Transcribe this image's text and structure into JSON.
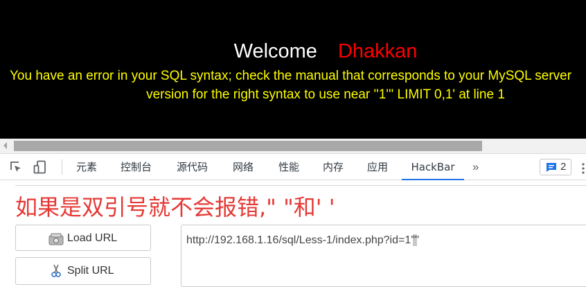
{
  "page": {
    "welcome_label": "Welcome",
    "welcome_name": "Dhakkan",
    "error_line1": "You have an error in your SQL syntax; check the manual that corresponds to your MySQL server",
    "error_line2": "version for the right syntax to use near ''1''' LIMIT 0,1' at line 1",
    "colors": {
      "background": "#000000",
      "welcome": "#ffffff",
      "name": "#ff0000",
      "error": "#ffff00"
    }
  },
  "devtools": {
    "tools": [
      "inspect-element-icon",
      "device-toolbar-icon"
    ],
    "tabs": [
      {
        "label": "元素"
      },
      {
        "label": "控制台"
      },
      {
        "label": "源代码"
      },
      {
        "label": "网络"
      },
      {
        "label": "性能"
      },
      {
        "label": "内存"
      },
      {
        "label": "应用"
      },
      {
        "label": "HackBar",
        "active": true
      }
    ],
    "more_label": "»",
    "messages_count": "2",
    "accent": "#1a73e8"
  },
  "hackbar": {
    "annotation": "如果是双引号就不会报错,\" \"和' '",
    "load_url_label": "Load URL",
    "split_url_label": "Split URL",
    "url_value": "http://192.168.1.16/sql/Less-1/index.php?id=1'\"'",
    "url_before_caret": "http://192.168.1.16/sql/Less-1/index.php?id=1'",
    "url_caret_char": "\"",
    "url_after_caret": "'",
    "annotation_color": "#e53935"
  }
}
